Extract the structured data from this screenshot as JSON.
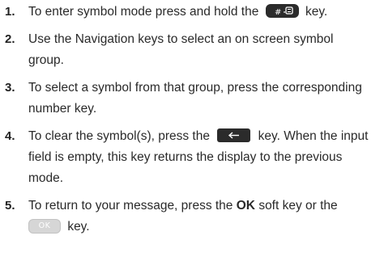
{
  "steps": [
    {
      "number": "1.",
      "text_before": "To enter symbol mode press and hold the",
      "key_icon": "hash-symbol-key-icon",
      "text_after": "key."
    },
    {
      "number": "2.",
      "line1": "Use the Navigation keys to select an on screen symbol",
      "line2": "group."
    },
    {
      "number": "3.",
      "line1": "To select a symbol from that group, press the corresponding",
      "line2": "number key."
    },
    {
      "number": "4.",
      "text_before": "To clear the symbol(s), press the",
      "key_icon": "back-clear-key-icon",
      "text_after": "key. When the input",
      "line2": "field is empty, this key returns the display to the previous",
      "line3": "mode."
    },
    {
      "number": "5.",
      "text_before": "To return to your message, press the",
      "bold": "OK",
      "text_after": "soft key or the",
      "key_icon": "ok-key-icon",
      "key_label": "OK",
      "line2_after": "key."
    }
  ],
  "colors": {
    "text": "#222222",
    "dark_key": "#2b2b2b",
    "ok_key": "#d6d6d6"
  }
}
